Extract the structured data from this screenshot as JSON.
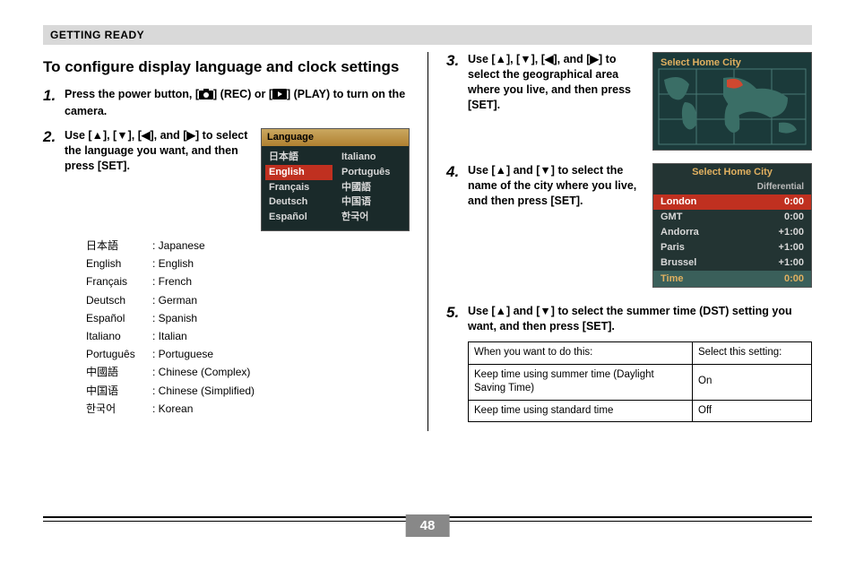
{
  "header": "GETTING READY",
  "title": "To configure display language and clock settings",
  "page_number": "48",
  "steps": {
    "s1": {
      "num": "1.",
      "text_a": "Press the power button, [",
      "text_b": "] (REC) or [",
      "text_c": "] (PLAY) to turn on the camera."
    },
    "s2": {
      "num": "2.",
      "text": "Use [▲], [▼], [◀], and [▶] to select the language you want, and then press [SET]."
    },
    "s3": {
      "num": "3.",
      "text": "Use [▲], [▼], [◀], and [▶] to select the geographical area where you live, and then press [SET]."
    },
    "s4": {
      "num": "4.",
      "text": "Use [▲] and [▼] to select the name of the city where you live, and then press [SET]."
    },
    "s5": {
      "num": "5.",
      "text": "Use [▲] and [▼] to select the summer time (DST) setting you want, and then press [SET]."
    }
  },
  "lang_list": [
    {
      "native": "日本語",
      "en": "Japanese"
    },
    {
      "native": "English",
      "en": "English"
    },
    {
      "native": "Français",
      "en": "French"
    },
    {
      "native": "Deutsch",
      "en": "German"
    },
    {
      "native": "Español",
      "en": "Spanish"
    },
    {
      "native": "Italiano",
      "en": "Italian"
    },
    {
      "native": "Português",
      "en": "Portuguese"
    },
    {
      "native": "中國語",
      "en": "Chinese (Complex)"
    },
    {
      "native": "中国语",
      "en": "Chinese (Simplified)"
    },
    {
      "native": "한국어",
      "en": "Korean"
    }
  ],
  "lang_shot": {
    "title": "Language",
    "col1": [
      "日本語",
      "English",
      "Français",
      "Deutsch",
      "Español"
    ],
    "col2": [
      "Italiano",
      "Português",
      "中國語",
      "中国语",
      "한국어"
    ],
    "selected_index": 1
  },
  "map_shot": {
    "title": "Select Home City"
  },
  "city_shot": {
    "title": "Select Home City",
    "subtitle": "Differential",
    "rows": [
      {
        "city": "London",
        "diff": "0:00",
        "sel": true
      },
      {
        "city": "GMT",
        "diff": "0:00",
        "sel": false
      },
      {
        "city": "Andorra",
        "diff": "+1:00",
        "sel": false
      },
      {
        "city": "Paris",
        "diff": "+1:00",
        "sel": false
      },
      {
        "city": "Brussel",
        "diff": "+1:00",
        "sel": false
      }
    ],
    "time_label": "Time",
    "time_value": "0:00"
  },
  "dst_table": {
    "h1": "When you want to do this:",
    "h2": "Select this setting:",
    "r1a": "Keep time using summer time (Daylight Saving Time)",
    "r1b": "On",
    "r2a": "Keep time using standard time",
    "r2b": "Off"
  }
}
